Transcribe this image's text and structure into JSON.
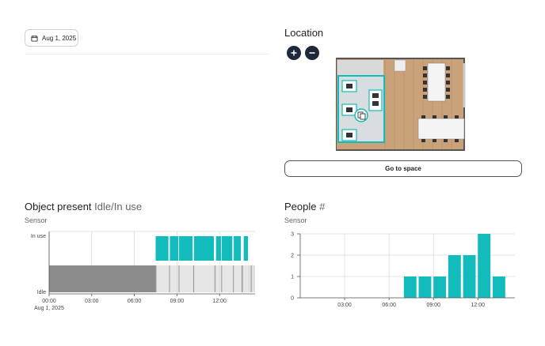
{
  "date_picker": {
    "label": "Aug 1, 2025"
  },
  "location": {
    "title": "Location",
    "zoom_in": "+",
    "zoom_out": "−",
    "goto_label": "Go to space"
  },
  "object_present": {
    "title": "Object present",
    "title_suffix": "Idle/In use",
    "subtitle": "Sensor"
  },
  "people": {
    "title": "People",
    "title_suffix": "#",
    "subtitle": "Sensor"
  },
  "colors": {
    "accent": "#12bcbc",
    "idle": "#8c8c8c",
    "dark_button": "#1e2a3a"
  },
  "chart_data": [
    {
      "type": "timeline",
      "title": "Object present",
      "y_categories": [
        "Idle",
        "In use"
      ],
      "x_ticks": [
        "00:00",
        "03:00",
        "06:00",
        "09:00",
        "12:00"
      ],
      "x_date_label": "Aug 1, 2025",
      "xlim_hours": [
        0,
        14.5
      ],
      "segments": [
        {
          "start": 0.0,
          "end": 7.5,
          "state": "Idle",
          "confidence": "solid"
        },
        {
          "start": 7.5,
          "end": 8.4,
          "state": "In use"
        },
        {
          "start": 8.4,
          "end": 8.5,
          "state": "Idle"
        },
        {
          "start": 8.5,
          "end": 9.1,
          "state": "In use"
        },
        {
          "start": 9.1,
          "end": 9.15,
          "state": "Idle"
        },
        {
          "start": 9.15,
          "end": 10.1,
          "state": "In use"
        },
        {
          "start": 10.1,
          "end": 10.2,
          "state": "Idle"
        },
        {
          "start": 10.2,
          "end": 11.6,
          "state": "In use"
        },
        {
          "start": 11.6,
          "end": 11.75,
          "state": "Idle"
        },
        {
          "start": 11.75,
          "end": 12.1,
          "state": "In use"
        },
        {
          "start": 12.1,
          "end": 12.15,
          "state": "Idle"
        },
        {
          "start": 12.15,
          "end": 12.9,
          "state": "In use"
        },
        {
          "start": 12.9,
          "end": 13.0,
          "state": "Idle"
        },
        {
          "start": 13.0,
          "end": 13.5,
          "state": "In use"
        },
        {
          "start": 13.5,
          "end": 13.7,
          "state": "Idle"
        },
        {
          "start": 13.7,
          "end": 14.0,
          "state": "In use"
        },
        {
          "start": 14.0,
          "end": 14.5,
          "state": "Idle"
        }
      ]
    },
    {
      "type": "bar",
      "title": "People",
      "x_ticks": [
        "03:00",
        "06:00",
        "09:00",
        "12:00"
      ],
      "xlim_hours": [
        0,
        14.5
      ],
      "ylim": [
        0,
        3
      ],
      "y_ticks": [
        0,
        1,
        2,
        3
      ],
      "bars": [
        {
          "hour": 7,
          "value": 1
        },
        {
          "hour": 8,
          "value": 1
        },
        {
          "hour": 9,
          "value": 1
        },
        {
          "hour": 10,
          "value": 2
        },
        {
          "hour": 11,
          "value": 2
        },
        {
          "hour": 12,
          "value": 3
        },
        {
          "hour": 13,
          "value": 1
        }
      ]
    }
  ]
}
